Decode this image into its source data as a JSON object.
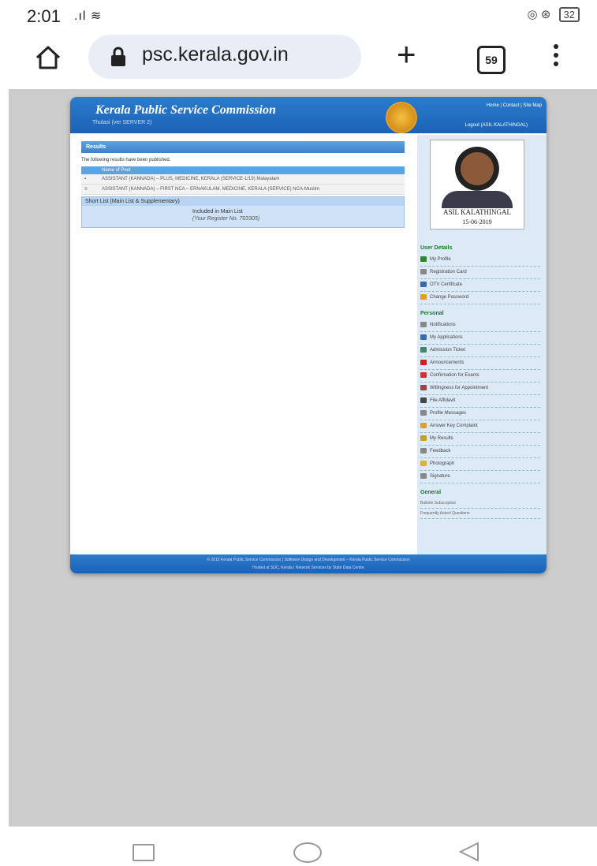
{
  "status": {
    "time": "2:01",
    "battery": "32"
  },
  "browser": {
    "url": "psc.kerala.gov.in",
    "tab_count": "59"
  },
  "site": {
    "title": "Kerala Public Service Commission",
    "subtitle": "Thulasi (ver SERVER 2)",
    "top_links": "Home | Contact | Site Map",
    "logout": "Logout (ASIL KALATHINGAL)"
  },
  "results": {
    "heading": "Results",
    "intro": "The following results have been published.",
    "column_header": "Name of Post",
    "rows": [
      {
        "marker": "▪",
        "text": "ASSISTANT (KANNADA) – PLUS, MEDICINE, KERALA (SERVICE-1/19) Malayalam"
      },
      {
        "marker": "≡",
        "text": "ASSISTANT (KANNADA) – FIRST NCA – ERNAKULAM, MEDICINE, KERALA (SERVICE) NCA-Muslim"
      }
    ],
    "shortlist_header": "Short List (Main List & Supplementary)",
    "included_text": "Included in Main List",
    "register_text": "(Your Register No. 703305)"
  },
  "profile": {
    "name": "ASIL KALATHINGAL",
    "date": "15-06-2019",
    "side_label": "Photo"
  },
  "sidebar": {
    "user_details_heading": "User Details",
    "user_details": [
      {
        "label": "My Profile",
        "color": "#2a8a2a"
      },
      {
        "label": "Registration Card",
        "color": "#888888"
      },
      {
        "label": "OTV Certificate",
        "color": "#3a6ab0"
      },
      {
        "label": "Change Password",
        "color": "#e0a020"
      }
    ],
    "personal_heading": "Personal",
    "personal": [
      {
        "label": "Notifications",
        "color": "#888888"
      },
      {
        "label": "My Applications",
        "color": "#3a6ab0"
      },
      {
        "label": "Admission Ticket",
        "color": "#3a8a6a"
      },
      {
        "label": "Announcements",
        "color": "#cc2222"
      },
      {
        "label": "Confirmation for Exams",
        "color": "#cc3333"
      },
      {
        "label": "Willingness for Appointment",
        "color": "#a04040"
      },
      {
        "label": "File Affidavit",
        "color": "#444444"
      },
      {
        "label": "Profile Messages",
        "color": "#888888"
      },
      {
        "label": "Answer Key Complaint",
        "color": "#e0a020"
      },
      {
        "label": "My Results",
        "color": "#c8a020"
      },
      {
        "label": "Feedback",
        "color": "#888888"
      },
      {
        "label": "Photograph",
        "color": "#e0b030"
      },
      {
        "label": "Signature",
        "color": "#888888"
      }
    ],
    "general_heading": "General",
    "general": [
      {
        "label": "Bulletin Subscription"
      },
      {
        "label": "Frequently Asked Questions"
      }
    ]
  },
  "footer": {
    "line1": "© 2015 Kerala Public Service Commission | Software Design and Development – Kerala Public Service Commission",
    "line2": "Hosted at SDC, Kerala | Network Services by State Data Centre"
  }
}
